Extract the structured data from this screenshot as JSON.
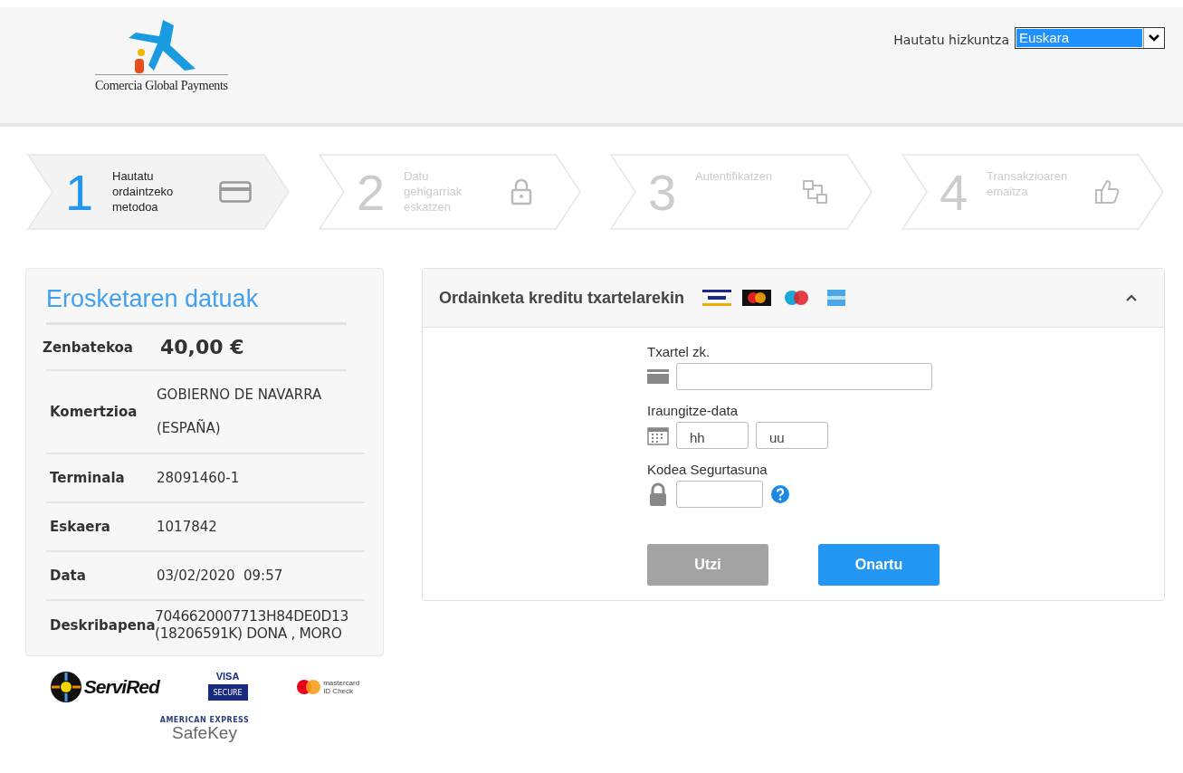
{
  "header": {
    "logo_text": "Comercia Global Payments",
    "language_label": "Hautatu hizkuntza",
    "language_value": "Euskara"
  },
  "steps": [
    {
      "number": "1",
      "label": "Hautatu ordaintzeko metodoa",
      "selected": true
    },
    {
      "number": "2",
      "label": "Datu gehigarriak eskatzen",
      "selected": false
    },
    {
      "number": "3",
      "label": "Autentifikatzen",
      "selected": false
    },
    {
      "number": "4",
      "label": "Transakzioaren emaitza",
      "selected": false
    }
  ],
  "purchase": {
    "title": "Erosketaren datuak",
    "rows": [
      {
        "label": "Zenbatekoa",
        "value": "40,00 €",
        "kind": "amount"
      },
      {
        "label": "Komertzioa",
        "value": "GOBIERNO DE NAVARRA (ESPAÑA)",
        "kind": "tall"
      },
      {
        "label": "Terminala",
        "value": "28091460-1",
        "kind": "plain"
      },
      {
        "label": "Eskaera",
        "value": "1017842",
        "kind": "plain"
      },
      {
        "label": "Data",
        "value": "03/02/2020  09:57",
        "kind": "plain"
      },
      {
        "label": "Deskribapena",
        "value": "7046620007713H84DE0D13 (18206591K) DONA , MORO",
        "kind": "compact"
      }
    ]
  },
  "payment": {
    "title": "Ordainketa kreditu txartelarekin",
    "expanded": true,
    "card_label": "Txartel zk.",
    "expiry_label": "Iraungitze-data",
    "month_placeholder": "hh",
    "year_placeholder": "uu",
    "cvv_label": "Kodea Segurtasuna",
    "buttons": [
      {
        "label": "Utzi",
        "disabled": true
      },
      {
        "label": "Onartu",
        "disabled": false
      }
    ]
  },
  "badges": {
    "servired": "ServiRed",
    "visa": "VISA",
    "visa_sub": "SECURE",
    "mastercard": "mastercard",
    "mastercard_sub": "ID Check",
    "amex": "AMERICAN EXPRESS",
    "amex_sub": "SafeKey"
  }
}
